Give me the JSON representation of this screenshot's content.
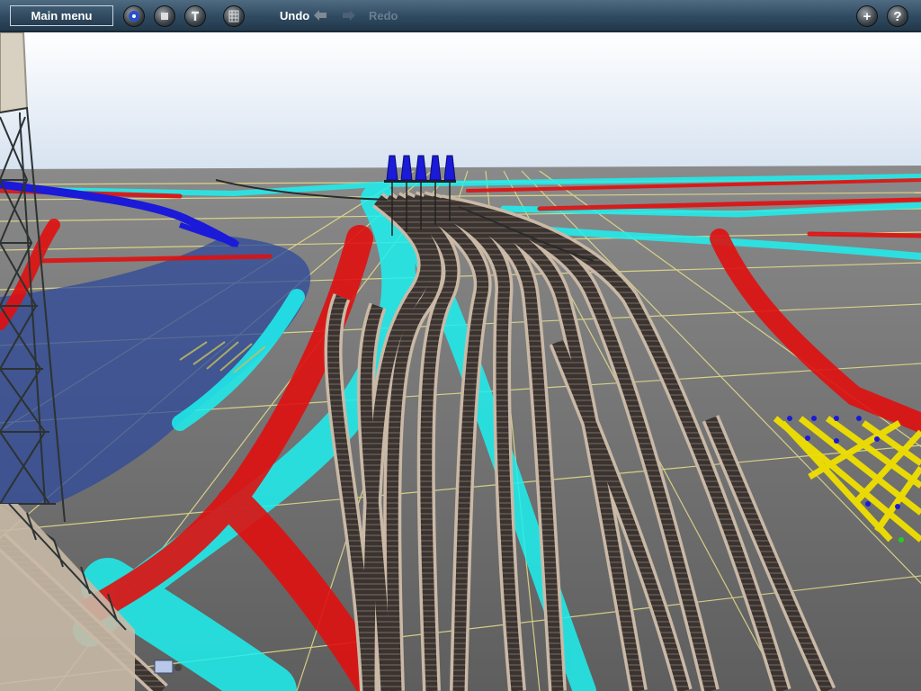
{
  "toolbar": {
    "main_menu_label": "Main menu",
    "undo_label": "Undo",
    "redo_label": "Redo",
    "icons": {
      "mode": "compass-icon",
      "stop": "stop-icon",
      "tools": "wrench-icon",
      "grid": "grid-icon",
      "undo_arrow": "arrow-left-icon",
      "redo_arrow": "arrow-right-icon",
      "add": "plus-icon",
      "help": "help-icon"
    },
    "help_glyph": "?",
    "add_glyph": "+"
  },
  "colors": {
    "toolbar": "#2f4a60",
    "sky_top": "#ffffff",
    "sky_bottom": "#d9e4f2",
    "ground": "#6f6f6f",
    "grid_lines": "#e8e08a",
    "water_heat": "#1ef0f0",
    "red_heat": "#e01010",
    "signal_blue": "#1a1ad8",
    "track_ballast": "#c9b9a6",
    "selection_yellow": "#f0e000"
  }
}
